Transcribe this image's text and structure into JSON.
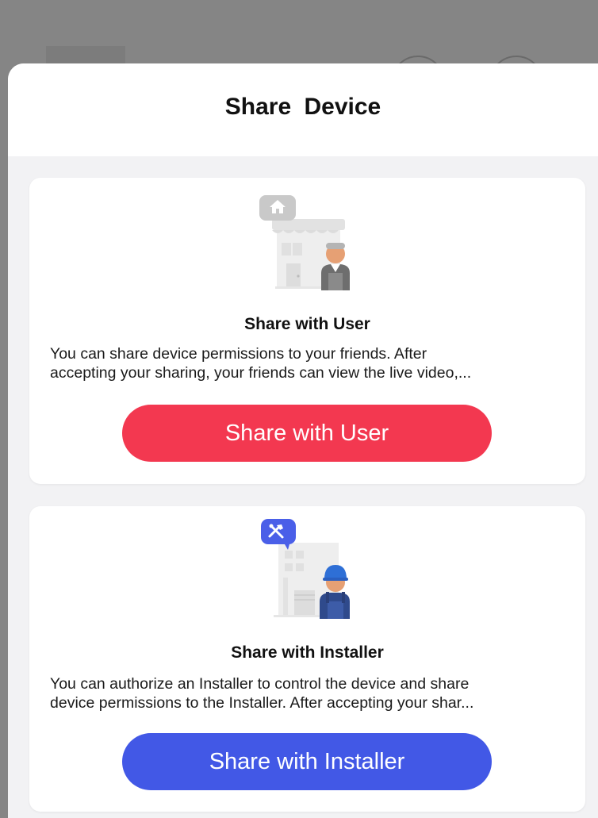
{
  "sheet": {
    "title": "Share Device"
  },
  "cards": [
    {
      "heading": "Share with User",
      "description_lines": [
        "You can share device permissions to your friends. After",
        "accepting your sharing, your friends can view the live video,..."
      ],
      "button_label": "Share with User",
      "accent": "#f33850",
      "icon": "home-icon"
    },
    {
      "heading": "Share with Installer",
      "description_lines": [
        "You can authorize an Installer to control the device and share",
        "device permissions to the Installer. After accepting your shar..."
      ],
      "button_label": "Share with Installer",
      "accent": "#4258e6",
      "icon": "tools-icon"
    }
  ]
}
